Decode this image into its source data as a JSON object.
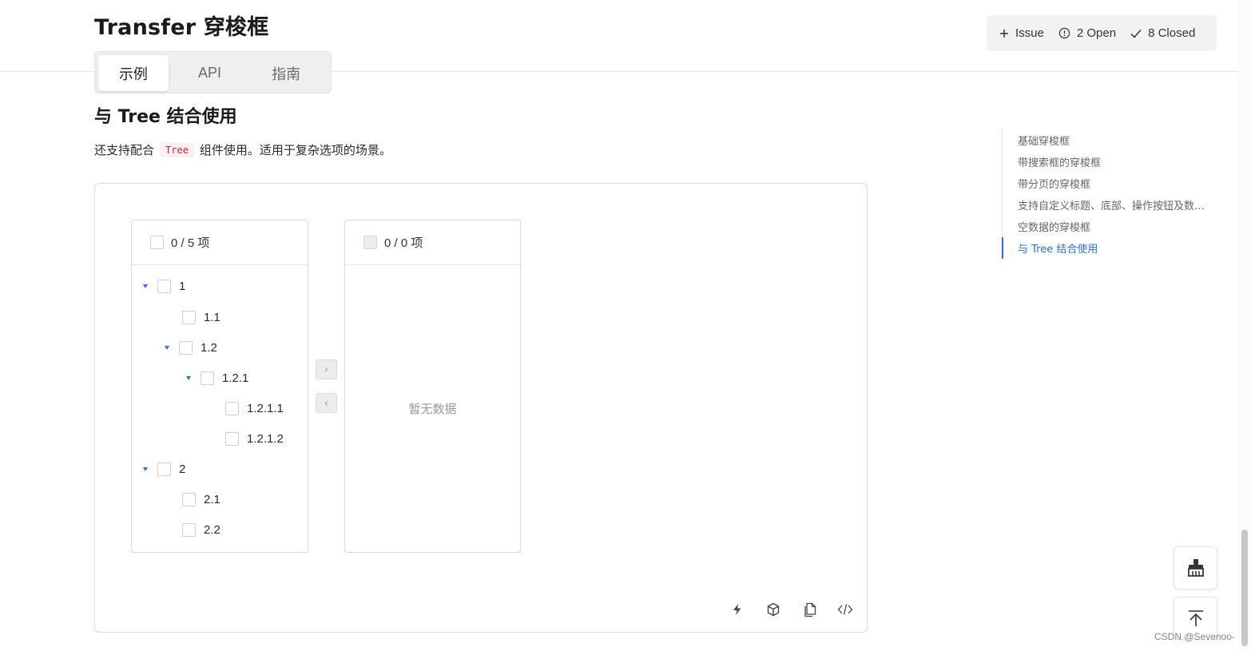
{
  "page": {
    "title": "Transfer 穿梭框"
  },
  "issues": {
    "new_label": "Issue",
    "open_label": "2 Open",
    "closed_label": "8 Closed"
  },
  "tabs": [
    {
      "label": "示例",
      "active": true
    },
    {
      "label": "API",
      "active": false
    },
    {
      "label": "指南",
      "active": false
    }
  ],
  "section": {
    "title": "与 Tree 结合使用",
    "desc_before": "还支持配合",
    "code": "Tree",
    "desc_after": "组件使用。适用于复杂选项的场景。"
  },
  "transfer": {
    "left": {
      "header": "0 / 5 项",
      "tree": [
        {
          "label": "1",
          "expanded": true
        },
        {
          "label": "1.1"
        },
        {
          "label": "1.2",
          "expanded": true
        },
        {
          "label": "1.2.1",
          "expanded": true
        },
        {
          "label": "1.2.1.1"
        },
        {
          "label": "1.2.1.2"
        },
        {
          "label": "2",
          "expanded": true
        },
        {
          "label": "2.1"
        },
        {
          "label": "2.2"
        }
      ]
    },
    "right": {
      "header": "0 / 0 项",
      "empty_text": "暂无数据"
    },
    "to_right": "›",
    "to_left": "‹"
  },
  "demo_actions": [
    "lightning-icon",
    "cube-icon",
    "copy-icon",
    "code-icon"
  ],
  "toc": {
    "items": [
      {
        "label": "基础穿梭框",
        "active": false
      },
      {
        "label": "带搜索框的穿梭框",
        "active": false
      },
      {
        "label": "带分页的穿梭框",
        "active": false
      },
      {
        "label": "支持自定义标题、底部、操作按钮及数…",
        "active": false
      },
      {
        "label": "空数据的穿梭框",
        "active": false
      },
      {
        "label": "与 Tree 结合使用",
        "active": true
      }
    ]
  },
  "floating": [
    "brush-icon",
    "back-to-top-icon"
  ],
  "watermark": "CSDN @Sevenoo-",
  "colors": {
    "accent": "#2f6fd6",
    "code_bg": "#fdeef0",
    "code_fg": "#c7254e"
  }
}
